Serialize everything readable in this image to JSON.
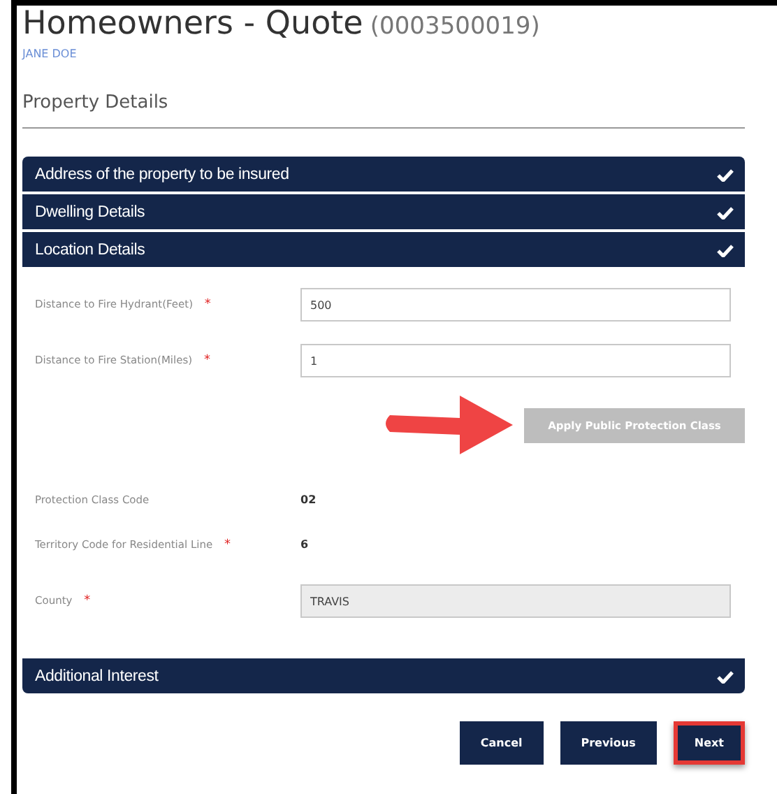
{
  "header": {
    "title": "Homeowners - Quote",
    "quote_number": "(0003500019)",
    "insured_name": "JANE DOE"
  },
  "section_title": "Property Details",
  "panels": [
    {
      "label": "Address of the property to be insured",
      "completed": true
    },
    {
      "label": "Dwelling Details",
      "completed": true
    },
    {
      "label": "Location Details",
      "completed": true
    }
  ],
  "fields": [
    {
      "kind": "input",
      "label": "Distance to Fire Hydrant(Feet)",
      "required_mark": "*",
      "value": "500"
    },
    {
      "kind": "input",
      "label": "Distance to Fire Station(Miles)",
      "required_mark": "*",
      "value": "1"
    },
    {
      "kind": "action",
      "label": "Apply Public Protection Class",
      "disabled": true,
      "annotated": true
    },
    {
      "kind": "value",
      "label": "Protection Class Code",
      "value": "02"
    },
    {
      "kind": "value",
      "label": "Territory Code for Residential Line",
      "required_mark": "*",
      "value": "6"
    },
    {
      "kind": "readonly",
      "label": "County",
      "required_mark": "*",
      "value": "TRAVIS"
    }
  ],
  "bottom_panels": [
    {
      "label": "Additional Interest",
      "completed": true
    }
  ],
  "buttons": [
    {
      "label": "Cancel",
      "highlighted": false
    },
    {
      "label": "Previous",
      "highlighted": false
    },
    {
      "label": "Next",
      "highlighted": true
    }
  ]
}
